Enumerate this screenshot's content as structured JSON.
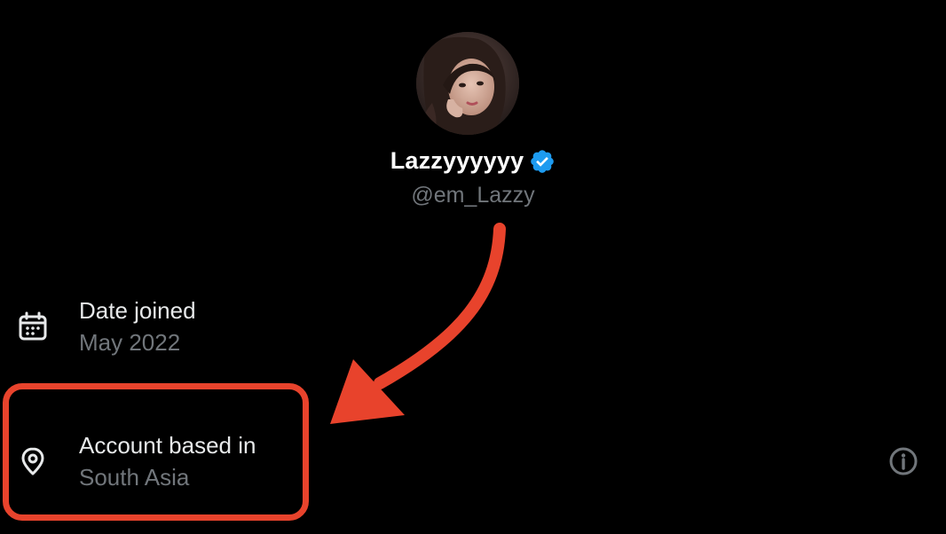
{
  "profile": {
    "display_name": "Lazzyyyyyy",
    "handle": "@em_Lazzy",
    "verified": true
  },
  "about": {
    "date_joined": {
      "label": "Date joined",
      "value": "May 2022",
      "icon": "calendar-icon"
    },
    "account_based_in": {
      "label": "Account based in",
      "value": "South Asia",
      "icon": "location-pin-icon"
    },
    "info_icon": "info-icon"
  },
  "annotation": {
    "color": "#e8432c"
  },
  "colors": {
    "background": "#000000",
    "primary_text": "#e7e9ea",
    "secondary_text": "#71767b",
    "verified_blue": "#1d9bf0"
  }
}
